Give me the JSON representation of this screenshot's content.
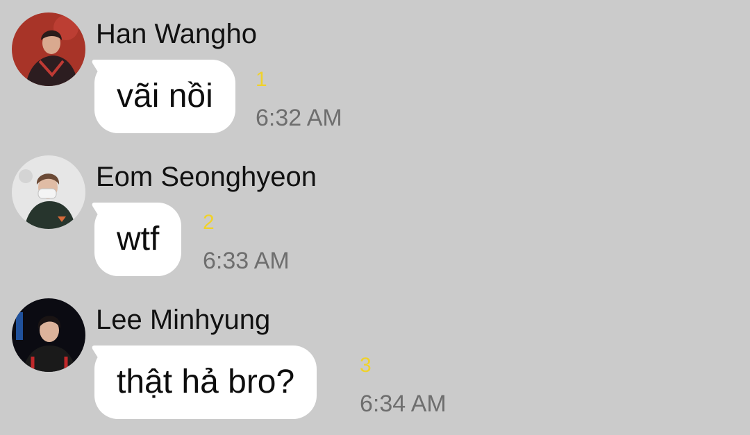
{
  "messages": [
    {
      "sender": "Han Wangho",
      "text": "vãi nồi",
      "unread": "1",
      "time": "6:32 AM",
      "avatar_colors": {
        "bg": "#a83428",
        "shirt": "#2c1d20",
        "skin": "#d9a98f",
        "hair": "#2a1c1a"
      }
    },
    {
      "sender": "Eom Seonghyeon",
      "text": "wtf",
      "unread": "2",
      "time": "6:33 AM",
      "avatar_colors": {
        "bg": "#e6e6e6",
        "shirt": "#27352d",
        "skin": "#e0bca5",
        "hair": "#6b4a36"
      }
    },
    {
      "sender": "Lee Minhyung",
      "text": "thật hả bro?",
      "unread": "3",
      "time": "6:34 AM",
      "avatar_colors": {
        "bg": "#0b0b12",
        "shirt": "#1a1a1a",
        "skin": "#dcb39b",
        "hair": "#1a1414"
      }
    }
  ],
  "colors": {
    "background": "#cbcbcb",
    "bubble": "#ffffff",
    "unread_badge": "#f0d22a",
    "timestamp": "#6e6e6e"
  }
}
